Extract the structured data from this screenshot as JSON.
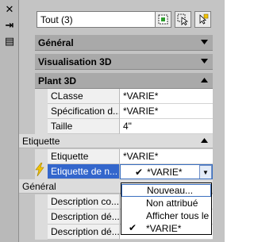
{
  "window": {
    "close_glyph": "✕",
    "autohide_glyph": "⇥",
    "properties_glyph": "▤"
  },
  "toolbar": {
    "selection_value": "Tout (3)",
    "quick_select_icon": "quick-select-icon",
    "select_objects_icon": "select-objects-icon",
    "toggle_pickadd_icon": "pickadd-icon"
  },
  "categories": {
    "general": "Général",
    "visualisation": "Visualisation 3D",
    "plant3d": "Plant 3D"
  },
  "plant3d_rows": [
    {
      "name": "CLasse",
      "value": "*VARIE*"
    },
    {
      "name": "Spécification d...",
      "value": "*VARIE*"
    },
    {
      "name": "Taille",
      "value": "4\""
    }
  ],
  "etiquette_section": "Etiquette",
  "etiquette_rows": [
    {
      "name": "Etiquette",
      "value": "*VARIE*"
    },
    {
      "name": "Etiquette de n...",
      "value": "*VARIE*"
    }
  ],
  "general_section": "Général",
  "general_rows": [
    {
      "name": "Description co...",
      "value": ""
    },
    {
      "name": "Description dé...",
      "value": ""
    },
    {
      "name": "Description dé...",
      "value": ""
    }
  ],
  "dropdown": {
    "items": [
      "Nouveau...",
      "Non attribué",
      "Afficher tous le",
      "*VARIE*"
    ],
    "checked_index": 3
  },
  "colors": {
    "selection_blue": "#3366cc",
    "lightning_yellow": "#f2c200"
  }
}
